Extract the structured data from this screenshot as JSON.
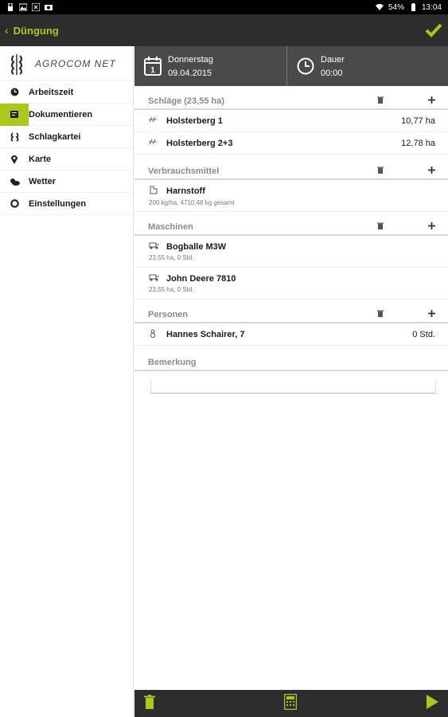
{
  "status_bar": {
    "battery": "54%",
    "time": "13:04"
  },
  "action_bar": {
    "back_glyph": "‹",
    "title": "Düngung"
  },
  "sidebar": {
    "logo_text": "AGROCOM NET",
    "items": [
      {
        "label": "Arbeitszeit",
        "icon": "clock-icon",
        "active": false
      },
      {
        "label": "Dokumentieren",
        "icon": "document-icon",
        "active": true
      },
      {
        "label": "Schlagkartei",
        "icon": "field-icon",
        "active": false
      },
      {
        "label": "Karte",
        "icon": "map-pin-icon",
        "active": false
      },
      {
        "label": "Wetter",
        "icon": "weather-icon",
        "active": false
      },
      {
        "label": "Einstellungen",
        "icon": "settings-icon",
        "active": false
      }
    ]
  },
  "header": {
    "day": "Donnerstag",
    "date": "09.04.2015",
    "calendar_digit": "1",
    "duration_label": "Dauer",
    "duration_value": "00:00"
  },
  "sections": {
    "fields": {
      "title": "Schläge (23,55 ha)",
      "rows": [
        {
          "name": "Holsterberg 1",
          "value": "10,77 ha"
        },
        {
          "name": "Holsterberg 2+3",
          "value": "12,78 ha"
        }
      ]
    },
    "consumables": {
      "title": "Verbrauchsmittel",
      "rows": [
        {
          "name": "Harnstoff",
          "sub": "200 kg/ha, 4710,48 kg gesamt"
        }
      ]
    },
    "machines": {
      "title": "Maschinen",
      "rows": [
        {
          "name": "Bogballe M3W",
          "sub": "23,55 ha, 0 Std."
        },
        {
          "name": "John Deere 7810",
          "sub": "23,55 ha, 0 Std."
        }
      ]
    },
    "persons": {
      "title": "Personen",
      "rows": [
        {
          "name": "Hannes Schairer, 7",
          "value": "0 Std."
        }
      ]
    },
    "remarks": {
      "title": "Bemerkung",
      "value": ""
    }
  },
  "colors": {
    "accent": "#a8c81c",
    "bar_dark": "#2d2d2d",
    "header_bg": "#4a4a4a"
  }
}
